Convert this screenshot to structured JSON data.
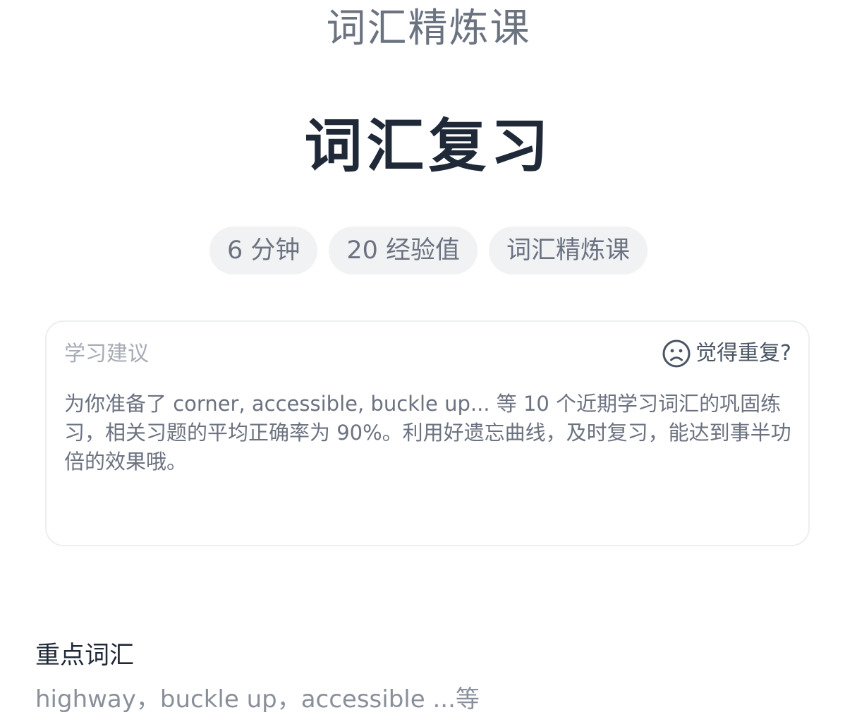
{
  "header": {
    "course_title": "词汇精炼课",
    "page_title": "词汇复习"
  },
  "tags": [
    {
      "label": "6 分钟"
    },
    {
      "label": "20 经验值"
    },
    {
      "label": "词汇精炼课"
    }
  ],
  "suggestion": {
    "label": "学习建议",
    "repeat_label": "觉得重复?",
    "repeat_icon": "sad-face-icon",
    "text": "为你准备了 corner, accessible, buckle up... 等 10 个近期学习词汇的巩固练习，相关习题的平均正确率为 90%。利用好遗忘曲线，及时复习，能达到事半功倍的效果哦。"
  },
  "key_vocab": {
    "heading": "重点词汇",
    "words": "highway，buckle up，accessible ...等"
  }
}
